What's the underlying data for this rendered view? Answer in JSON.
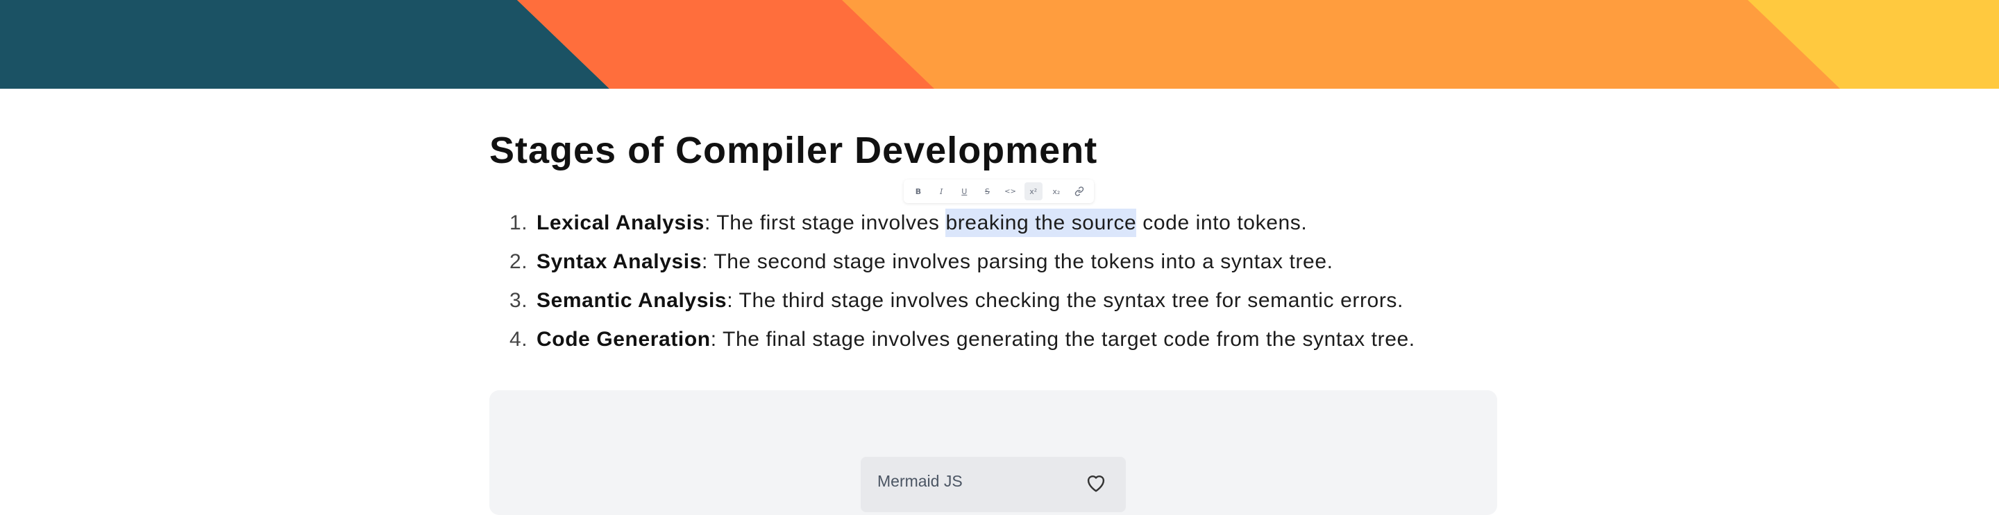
{
  "banner": {
    "colors": [
      "#1b5264",
      "#ff6e3c",
      "#ff9d3e",
      "#ffc93f"
    ]
  },
  "page": {
    "title": "Stages of Compiler Development"
  },
  "toolbar": {
    "buttons": [
      {
        "name": "bold",
        "label": "B"
      },
      {
        "name": "italic",
        "label": "I"
      },
      {
        "name": "underline",
        "label": "U"
      },
      {
        "name": "strikethrough",
        "label": "S"
      },
      {
        "name": "code",
        "label": "<>"
      },
      {
        "name": "superscript",
        "label": "x²",
        "active": true
      },
      {
        "name": "subscript",
        "label": "x₂"
      },
      {
        "name": "link",
        "label": "link"
      }
    ]
  },
  "list": {
    "items": [
      {
        "number": "1.",
        "term": "Lexical Analysis",
        "before": ": The first stage involves ",
        "selected": "breaking the source",
        "after": " code into tokens."
      },
      {
        "number": "2.",
        "term": "Syntax Analysis",
        "text": ": The second stage involves parsing the tokens into a syntax tree."
      },
      {
        "number": "3.",
        "term": "Semantic Analysis",
        "text": ": The third stage involves checking the syntax tree for semantic errors."
      },
      {
        "number": "4.",
        "term": "Code Generation",
        "text": ": The final stage involves generating the target code from the syntax tree."
      }
    ]
  },
  "diagram": {
    "card_label": "Mermaid JS",
    "icon": "heart-icon"
  }
}
